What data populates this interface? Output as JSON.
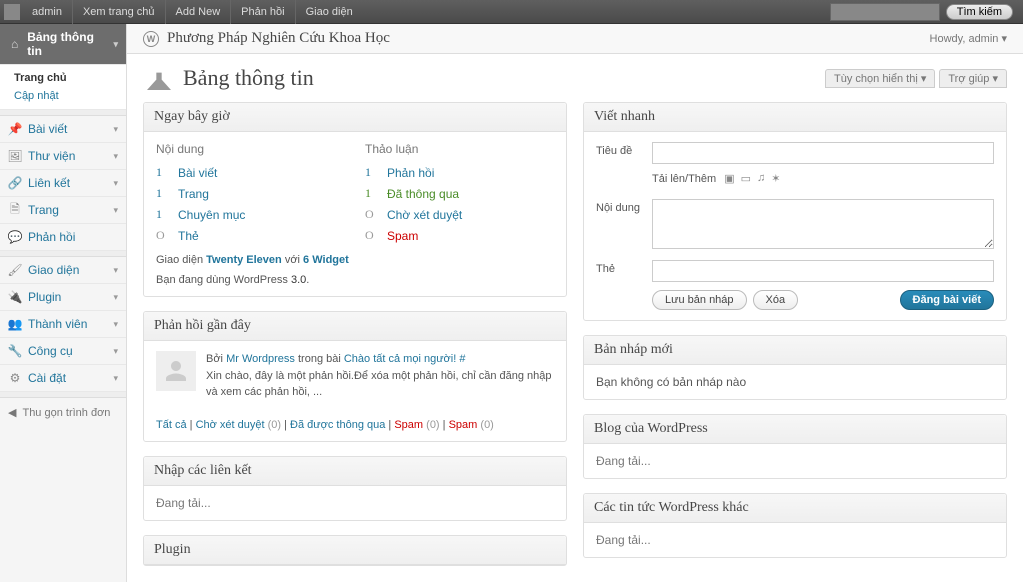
{
  "topbar": {
    "items": [
      "admin",
      "Xem trang chủ",
      "Add New",
      "Phản hồi",
      "Giao diện"
    ],
    "search_btn": "Tìm kiếm"
  },
  "header": {
    "site_title": "Phương Pháp Nghiên Cứu Khoa Học",
    "howdy": "Howdy, admin ▾"
  },
  "title": {
    "heading": "Bảng thông tin",
    "screen_options": "Tùy chọn hiển thị ▾",
    "help": "Trợ giúp ▾"
  },
  "sidebar": {
    "dashboard": "Bảng thông tin",
    "dashboard_sub": {
      "home": "Trang chủ",
      "updates": "Cập nhật"
    },
    "posts": "Bài viết",
    "media": "Thư viện",
    "links": "Liên kết",
    "pages": "Trang",
    "comments": "Phản hồi",
    "appearance": "Giao diện",
    "plugins": "Plugin",
    "users": "Thành viên",
    "tools": "Công cụ",
    "settings": "Cài đặt",
    "collapse": "Thu gọn trình đơn"
  },
  "right_now": {
    "title": "Ngay bây giờ",
    "content_h": "Nội dung",
    "discussion_h": "Thảo luận",
    "content": [
      {
        "n": "1",
        "label": "Bài viết",
        "z": false
      },
      {
        "n": "1",
        "label": "Trang",
        "z": false
      },
      {
        "n": "1",
        "label": "Chuyên mục",
        "z": false
      },
      {
        "n": "O",
        "label": "Thẻ",
        "z": true
      }
    ],
    "discussion": [
      {
        "n": "1",
        "label": "Phản hồi",
        "cls": ""
      },
      {
        "n": "1",
        "label": "Đã thông qua",
        "cls": "green"
      },
      {
        "n": "O",
        "label": "Chờ xét duyệt",
        "cls": "",
        "z": true
      },
      {
        "n": "O",
        "label": "Spam",
        "cls": "red",
        "z": true
      }
    ],
    "theme_pre": "Giao diện ",
    "theme_name": "Twenty Eleven",
    "theme_mid": " với ",
    "theme_widgets": "6 Widget",
    "version_pre": "Bạn đang dùng WordPress ",
    "version": "3.0"
  },
  "recent_comments": {
    "title": "Phản hồi gần đây",
    "by": "Bởi ",
    "author": "Mr Wordpress",
    "on": " trong bài ",
    "post": "Chào tất cả mọi người!",
    "hash": " #",
    "text": "Xin chào, đây là một phản hồi.Để xóa một phản hồi, chỉ cần đăng nhập và xem các phản hồi, ...",
    "filters": {
      "all": "Tất cả",
      "pending": "Chờ xét duyệt",
      "pending_n": "(0)",
      "approved": "Đã được thông qua",
      "spam1": "Spam",
      "spam1_n": "(0)",
      "spam2": "Spam",
      "spam2_n": "(0)"
    }
  },
  "incoming_links": {
    "title": "Nhập các liên kết",
    "loading": "Đang tải..."
  },
  "plugins_box": {
    "title": "Plugin"
  },
  "quickpress": {
    "title": "Viết nhanh",
    "title_label": "Tiêu đề",
    "upload_label": "Tải lên/Thêm",
    "content_label": "Nội dung",
    "tags_label": "Thẻ",
    "save_draft": "Lưu bản nháp",
    "reset": "Xóa",
    "publish": "Đăng bài viết"
  },
  "drafts": {
    "title": "Bản nháp mới",
    "empty": "Bạn không có bản nháp nào"
  },
  "wp_blog": {
    "title": "Blog của WordPress",
    "loading": "Đang tải..."
  },
  "wp_news": {
    "title": "Các tin tức WordPress khác",
    "loading": "Đang tải..."
  }
}
